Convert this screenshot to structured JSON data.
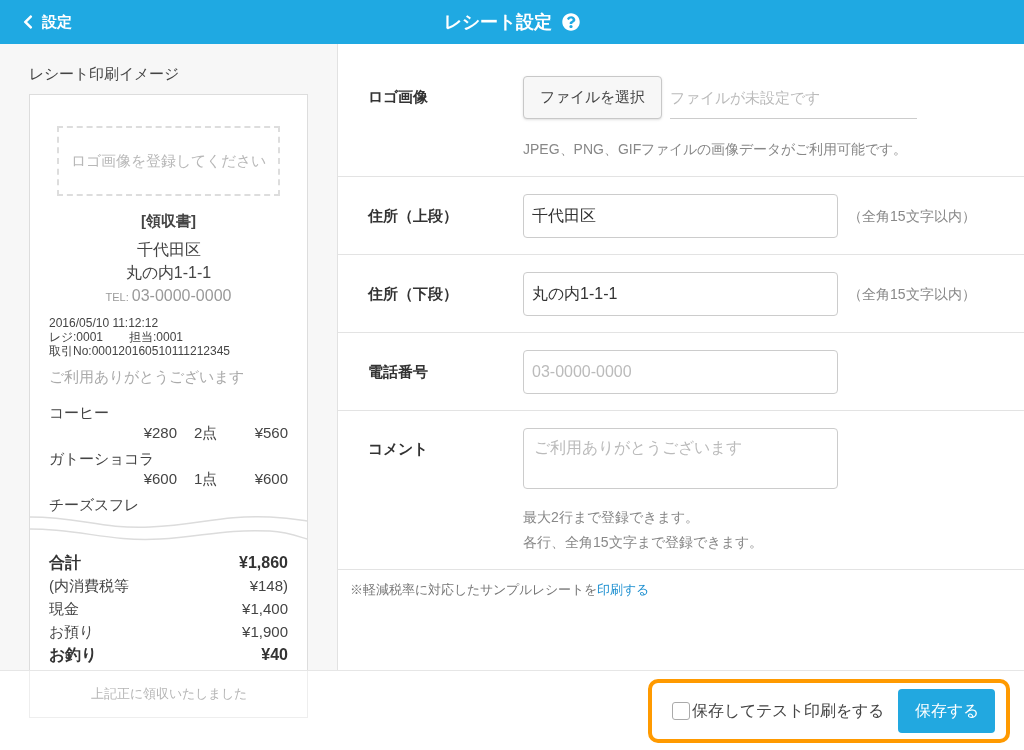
{
  "header": {
    "back_label": "設定",
    "title": "レシート設定"
  },
  "preview": {
    "heading": "レシート印刷イメージ",
    "receipt": {
      "logo_placeholder": "ロゴ画像を登録してください",
      "title": "[領収書]",
      "address_lines": [
        "千代田区",
        "丸の内1-1-1"
      ],
      "tel_label": "TEL:",
      "tel": "03-0000-0000",
      "datetime": "2016/05/10 11:12:12",
      "register": "レジ:0001",
      "staff": "担当:0001",
      "transaction": "取引No:000120160510111212345",
      "comment": "ご利用ありがとうございます",
      "items": [
        {
          "name": "コーヒー",
          "unit_price": "¥280",
          "quantity": "2点",
          "amount": "¥560"
        },
        {
          "name": "ガトーショコラ",
          "unit_price": "¥600",
          "quantity": "1点",
          "amount": "¥600"
        },
        {
          "name": "チーズスフレ"
        }
      ],
      "totals": [
        {
          "label": "合計",
          "value": "¥1,860",
          "bold": true
        },
        {
          "label": "(内消費税等",
          "value": "¥148)",
          "bold": false
        },
        {
          "label": "現金",
          "value": "¥1,400",
          "bold": false
        },
        {
          "label": "お預り",
          "value": "¥1,900",
          "bold": false
        },
        {
          "label": "お釣り",
          "value": "¥40",
          "bold": true
        }
      ],
      "footer_note": "上記正に領収いたしました"
    }
  },
  "form": {
    "rows": [
      {
        "kind": "file",
        "label": "ロゴ画像",
        "button": "ファイルを選択",
        "placeholder": "ファイルが未設定です",
        "help": [
          "JPEG、PNG、GIFファイルの画像データがご利用可能です。"
        ]
      },
      {
        "kind": "text",
        "label": "住所（上段）",
        "value": "千代田区",
        "hint": "（全角15文字以内）"
      },
      {
        "kind": "text",
        "label": "住所（下段）",
        "value": "丸の内1-1-1",
        "hint": "（全角15文字以内）"
      },
      {
        "kind": "text",
        "label": "電話番号",
        "placeholder": "03-0000-0000"
      },
      {
        "kind": "textarea",
        "label": "コメント",
        "placeholder": "ご利用ありがとうございます",
        "help": [
          "最大2行まで登録できます。",
          "各行、全角15文字まで登録できます。"
        ]
      }
    ],
    "note": "※軽減税率に対応したサンプルレシートを",
    "note_link": "印刷する"
  },
  "footer": {
    "test_print": {
      "label": "保存してテスト印刷をする",
      "checked": false
    },
    "save_button": "保存する"
  }
}
